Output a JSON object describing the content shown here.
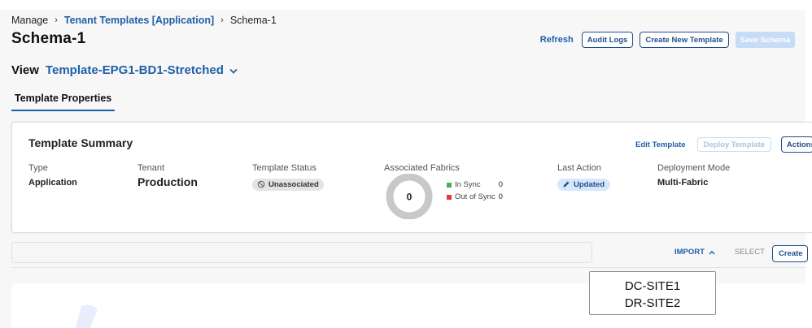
{
  "breadcrumb": {
    "root": "Manage",
    "parent": "Tenant Templates [Application]",
    "current": "Schema-1"
  },
  "page_title": "Schema-1",
  "header_actions": {
    "refresh": "Refresh",
    "audit_logs": "Audit Logs",
    "create_new_template": "Create New Template",
    "save_schema": "Save Schema"
  },
  "view": {
    "label": "View",
    "selected": "Template-EPG1-BD1-Stretched"
  },
  "tabs": [
    {
      "label": "Template Properties",
      "active": true
    }
  ],
  "summary": {
    "title": "Template Summary",
    "edit_template": "Edit Template",
    "deploy_template": "Deploy Template",
    "actions": "Actions",
    "type": {
      "label": "Type",
      "value": "Application"
    },
    "tenant": {
      "label": "Tenant",
      "value": "Production"
    },
    "template_status": {
      "label": "Template Status",
      "value": "Unassociated"
    },
    "associated_fabrics": {
      "label": "Associated Fabrics",
      "total": "0",
      "in_sync": {
        "label": "In Sync",
        "count": "0",
        "color": "#4caf50"
      },
      "out_of_sync": {
        "label": "Out of Sync",
        "count": "0",
        "color": "#e53935"
      }
    },
    "last_action": {
      "label": "Last Action",
      "value": "Updated"
    },
    "deployment_mode": {
      "label": "Deployment Mode",
      "value": "Multi-Fabric"
    }
  },
  "toolbar": {
    "import": "IMPORT",
    "select": "SELECT",
    "create": "Create"
  },
  "popup": {
    "items": [
      "DC-SITE1",
      "DR-SITE2"
    ]
  },
  "icons": {
    "breadcrumb_separator": "chevron-right-icon",
    "view_dropdown": "chevron-down-icon",
    "unassociated": "circle-slash-icon",
    "updated": "pencil-icon",
    "import_toggle": "chevron-up-icon"
  },
  "colors": {
    "accent": "#1f5fa8",
    "button_border": "#1f4e8c",
    "disabled": "#c7dcf6"
  }
}
